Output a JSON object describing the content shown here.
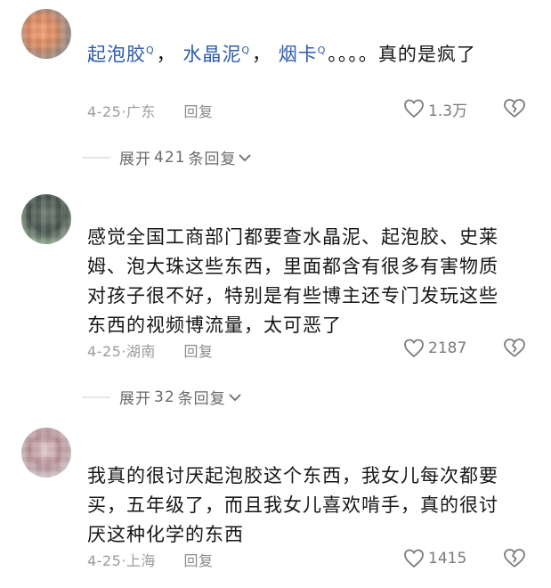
{
  "comments": [
    {
      "segments": {
        "kw1": "起泡胶",
        "sep1": "，",
        "kw2": "水晶泥",
        "sep2": "，",
        "kw3": "烟卡",
        "rest": "。。。。真的是疯了"
      },
      "date": "4-25",
      "location": "广东",
      "reply_label": "回复",
      "likes": "1.3万",
      "expand": {
        "prefix": "展开",
        "count": "421",
        "suffix": "条回复"
      }
    },
    {
      "text": "感觉全国工商部门都要查水晶泥、起泡胶、史莱姆、泡大珠这些东西，里面都含有很多有害物质对孩子很不好，特别是有些博主还专门发玩这些东西的视频博流量，太可恶了",
      "date": "4-25",
      "location": "湖南",
      "reply_label": "回复",
      "likes": "2187",
      "expand": {
        "prefix": "展开",
        "count": "32",
        "suffix": "条回复"
      }
    },
    {
      "text": "我真的很讨厌起泡胶这个东西，我女儿每次都要买，五年级了，而且我女儿喜欢啃手，真的很讨厌这种化学的东西",
      "date": "4-25",
      "location": "上海",
      "reply_label": "回复",
      "likes": "1415"
    }
  ],
  "search_icon": "magnifier-icon",
  "icons": {
    "like": "heart-outline-icon",
    "dislike": "broken-heart-icon",
    "expand": "chevron-down-icon"
  },
  "colors": {
    "keyword": "#2d5cac",
    "text": "#161616",
    "meta": "#9b9b9b"
  }
}
